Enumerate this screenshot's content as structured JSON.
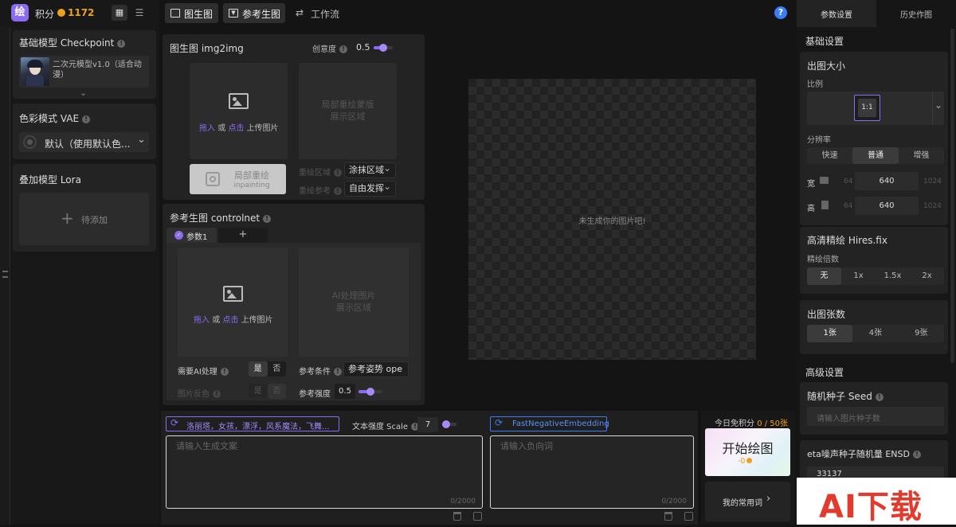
{
  "top": {
    "points_label": "积分",
    "points_value": "1172",
    "tabs": [
      {
        "label": "图生图",
        "active": true
      },
      {
        "label": "参考生图",
        "active": true
      },
      {
        "label": "工作流",
        "active": false
      }
    ],
    "help": "?"
  },
  "left": {
    "checkpoint_title": "基础模型 Checkpoint",
    "checkpoint_model": "二次元模型v1.0（适合动漫）",
    "vae_title": "色彩模式 VAE",
    "vae_value": "默认（使用默认色...",
    "lora_title": "叠加模型 Lora",
    "lora_add": "待添加"
  },
  "img2img": {
    "title": "图生图 img2img",
    "creativity_label": "创意度",
    "creativity_value": "0.5",
    "creativity_level": 0.5,
    "upload_drag": "拖入",
    "upload_or": "或",
    "upload_click": "点击",
    "upload_suffix": "上传图片",
    "mask_line1": "局部重绘蒙版",
    "mask_line2": "展示区域",
    "inpaint_label": "局部重绘",
    "inpaint_sub": "inpainting",
    "repaint_area_label": "重绘区域",
    "repaint_area_value": "涂抹区域",
    "repaint_ref_label": "重绘参考",
    "repaint_ref_value": "自由发挥"
  },
  "controlnet": {
    "title": "参考生图 controlnet",
    "tab1": "参数1",
    "tab_add": "+",
    "upload_drag": "拖入",
    "upload_or": "或",
    "upload_click": "点击",
    "upload_suffix": "上传图片",
    "ai_line1": "AI处理图片",
    "ai_line2": "展示区域",
    "need_ai_label": "需要AI处理",
    "yes": "是",
    "no": "否",
    "invert_label": "图片反色",
    "invert_yes": "是",
    "invert_no": "否",
    "cond_label": "参考条件",
    "cond_value": "参考姿势 ope",
    "strength_label": "参考强度",
    "strength_value": "0.5",
    "strength_level": 0.5
  },
  "canvas": {
    "placeholder": "未生成你的图片吧!"
  },
  "prompt": {
    "tag": "洛丽塔，女孩，漂浮，风系魔法，飞舞...",
    "scale_label": "文本强度 Scale",
    "scale_value": "7",
    "scale_level": 0.3,
    "placeholder": "请输入生成文案",
    "counter": "0/2000",
    "neg_tag": "FastNegativeEmbedding",
    "neg_placeholder": "请输入负向词",
    "neg_counter": "0/2000"
  },
  "generate": {
    "free_label": "今日免积分",
    "free_value": "0 / 50张",
    "button": "开始绘图",
    "cost": "-0",
    "my_words": "我的常用词"
  },
  "right": {
    "tab_params": "参数设置",
    "tab_history": "历史作图",
    "basic": "基础设置",
    "size_title": "出图大小",
    "ratio_label": "比例",
    "ratio_value": "1:1",
    "res_label": "分辨率",
    "res_options": [
      "快速",
      "普通",
      "增强"
    ],
    "width_label": "宽",
    "width_min": "64",
    "width_value": "640",
    "width_max": "1024",
    "height_label": "高",
    "height_min": "64",
    "height_value": "640",
    "height_max": "1024",
    "hires_title": "高清精绘 Hires.fix",
    "hires_label": "精绘倍数",
    "hires_options": [
      "无",
      "1x",
      "1.5x",
      "2x"
    ],
    "count_title": "出图张数",
    "count_options": [
      "1张",
      "4张",
      "9张"
    ],
    "advanced": "高级设置",
    "seed_title": "随机种子 Seed",
    "seed_placeholder": "请输入图片种子数",
    "ensd_title": "eta噪声种子随机量 ENSD",
    "ensd_value": "33137"
  },
  "watermark": {
    "text": "AI下载"
  },
  "colors": {
    "accent": "#8b6cf0",
    "points": "#f0a020",
    "blue": "#3d7bf7"
  }
}
